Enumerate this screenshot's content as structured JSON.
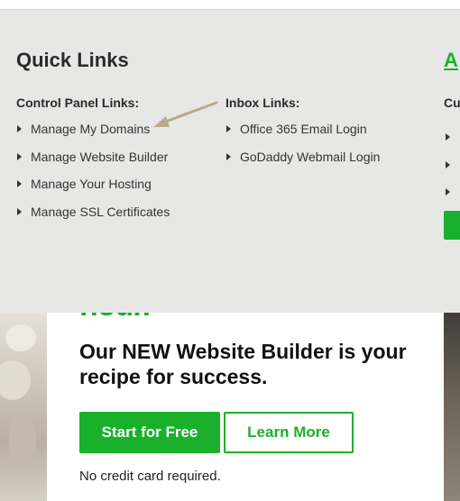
{
  "promo": {
    "headline_partial": "hour.",
    "headline": "Our NEW Website Builder is your recipe for success.",
    "primary_button": "Start for Free",
    "secondary_button": "Learn More",
    "note": "No credit card required."
  },
  "quick_links": {
    "title": "Quick Links",
    "right_title_partial": "A",
    "right_head_partial": "Cu",
    "control_panel": {
      "heading": "Control Panel Links:",
      "items": [
        "Manage My Domains",
        "Manage Website Builder",
        "Manage Your Hosting",
        "Manage SSL Certificates"
      ]
    },
    "inbox": {
      "heading": "Inbox Links:",
      "items": [
        "Office 365 Email Login",
        "GoDaddy Webmail Login"
      ]
    }
  },
  "colors": {
    "brand_green": "#1bb02c",
    "panel_bg": "#e7e8e6",
    "annotation_arrow": "#b8aa88"
  },
  "icons": {
    "bullet": "triangle-right-icon",
    "annotation": "arrow-annotation-icon"
  }
}
